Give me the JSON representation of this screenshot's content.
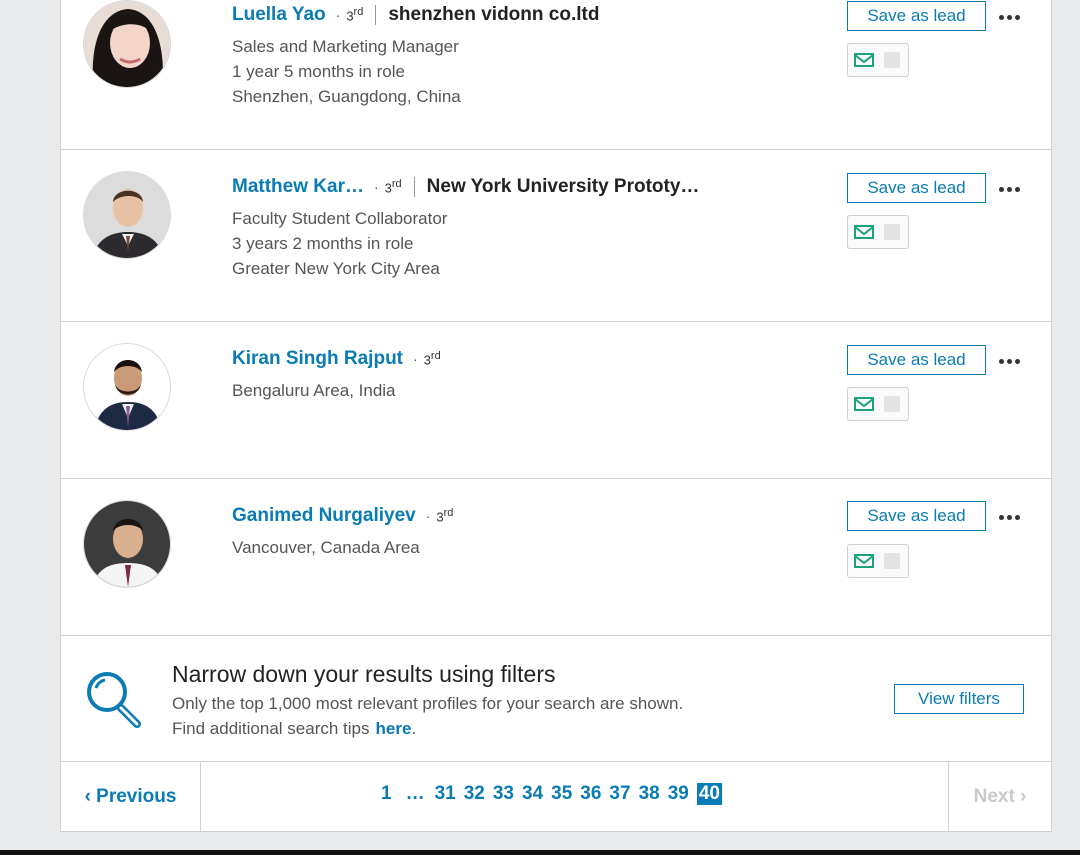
{
  "results": [
    {
      "name": "Luella Yao",
      "degree": "3",
      "degree_suffix": "rd",
      "company": "shenzhen vidonn co.ltd",
      "title": "Sales and Marketing Manager",
      "tenure": "1 year 5 months in role",
      "location": "Shenzhen, Guangdong, China"
    },
    {
      "name": "Matthew Kar…",
      "degree": "3",
      "degree_suffix": "rd",
      "company": "New York University Prototy…",
      "title": "Faculty Student Collaborator",
      "tenure": "3 years 2 months in role",
      "location": "Greater New York City Area"
    },
    {
      "name": "Kiran Singh Rajput",
      "degree": "3",
      "degree_suffix": "rd",
      "location": "Bengaluru Area, India"
    },
    {
      "name": "Ganimed Nurgaliyev",
      "degree": "3",
      "degree_suffix": "rd",
      "location": "Vancouver, Canada Area"
    }
  ],
  "actions": {
    "save_label": "Save as lead"
  },
  "filters": {
    "title": "Narrow down your results using filters",
    "line1": "Only the top 1,000 most relevant profiles for your search are shown.",
    "line2": "Find additional search tips",
    "link": "here",
    "link_suffix": ".",
    "button": "View filters"
  },
  "pagination": {
    "previous": "‹ Previous",
    "next": "Next ›",
    "first": "1",
    "ellipsis": "…",
    "pages": [
      "31",
      "32",
      "33",
      "34",
      "35",
      "36",
      "37",
      "38",
      "39"
    ],
    "current": "40"
  },
  "colors": {
    "link_blue": "#0a7bb5",
    "mail_green": "#1aa37a"
  }
}
